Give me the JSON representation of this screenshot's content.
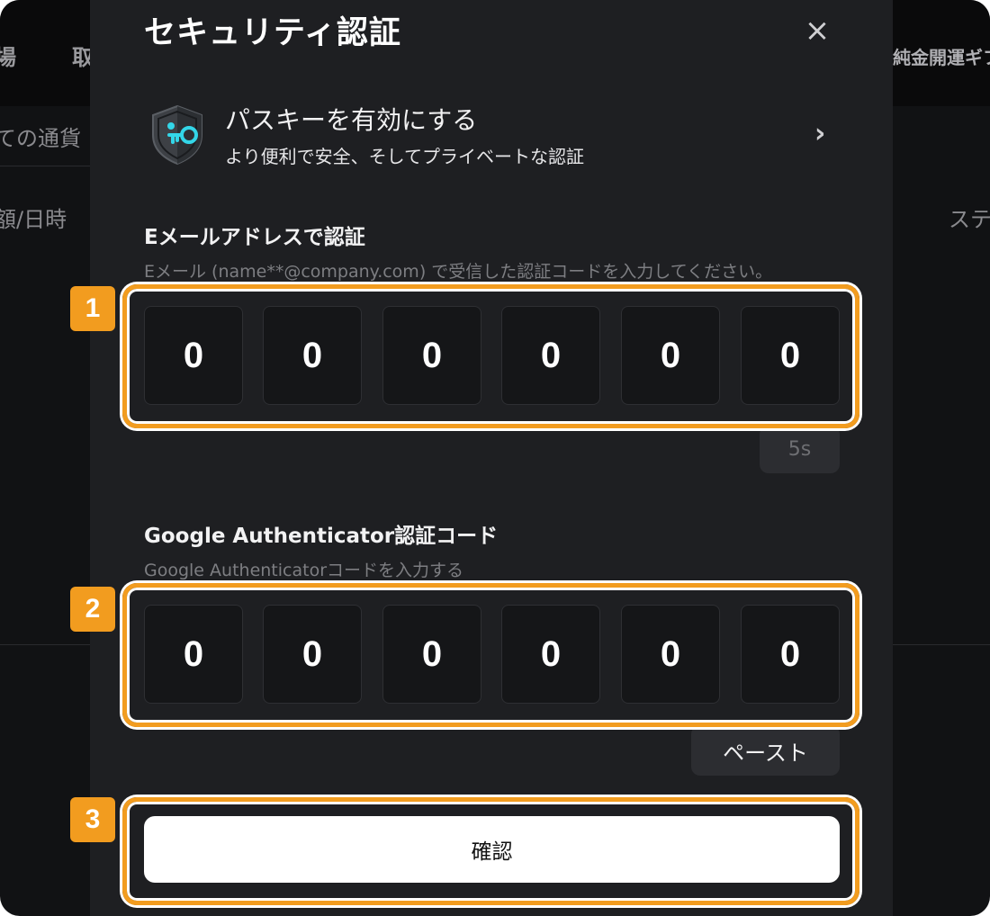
{
  "background": {
    "header_items": [
      "場",
      "取",
      "純金開運ギフ"
    ],
    "filter_tab": "ての通貨",
    "table_headers": [
      "額/日時",
      "ステ"
    ]
  },
  "modal": {
    "title": "セキュリティ認証",
    "close_icon": "×",
    "passkey": {
      "title": "パスキーを有効にする",
      "subtitle": "より便利で安全、そしてプライベートな認証",
      "chevron": "›"
    },
    "email_section": {
      "title": "Eメールアドレスで認証",
      "description": "Eメール (name**@company.com) で受信した認証コードを入力してください。",
      "digits": [
        "0",
        "0",
        "0",
        "0",
        "0",
        "0"
      ],
      "resend_label": "5s"
    },
    "ga_section": {
      "title": "Google Authenticator認証コード",
      "description": "Google Authenticatorコードを入力する",
      "digits": [
        "0",
        "0",
        "0",
        "0",
        "0",
        "0"
      ],
      "paste_label": "ペースト"
    },
    "confirm_label": "確認"
  },
  "annotations": {
    "markers": [
      "1",
      "2",
      "3"
    ],
    "color": "#f29c1f"
  }
}
